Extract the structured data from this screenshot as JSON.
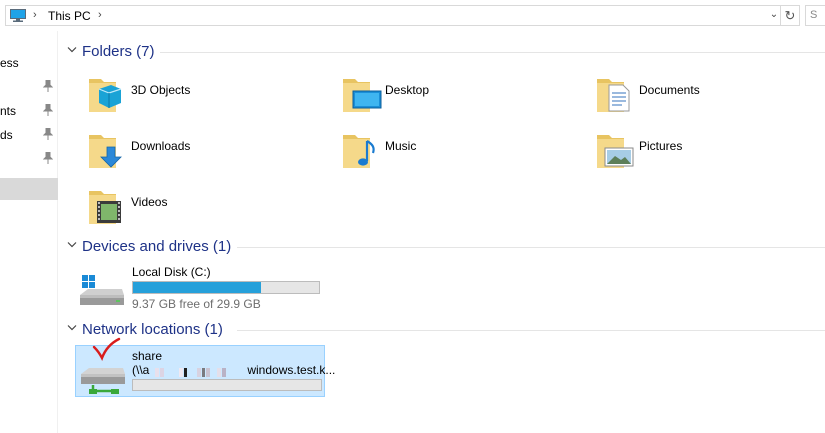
{
  "address_bar": {
    "crumb": "This PC",
    "search_placeholder": "S"
  },
  "nav": {
    "items": [
      {
        "label": "ess",
        "pinned": false
      },
      {
        "label": "nts",
        "pinned": true
      },
      {
        "label": "ds",
        "pinned": true
      },
      {
        "label": "",
        "pinned": true
      },
      {
        "label": "",
        "pinned": true
      }
    ]
  },
  "groups": {
    "folders": {
      "title": "Folders (7)",
      "items": [
        {
          "name": "3D Objects",
          "icon": "3d-objects-folder-icon"
        },
        {
          "name": "Desktop",
          "icon": "desktop-folder-icon"
        },
        {
          "name": "Documents",
          "icon": "documents-folder-icon"
        },
        {
          "name": "Downloads",
          "icon": "downloads-folder-icon"
        },
        {
          "name": "Music",
          "icon": "music-folder-icon"
        },
        {
          "name": "Pictures",
          "icon": "pictures-folder-icon"
        },
        {
          "name": "Videos",
          "icon": "videos-folder-icon"
        }
      ]
    },
    "devices": {
      "title": "Devices and drives (1)",
      "drive": {
        "name": "Local Disk (C:)",
        "free_text": "9.37 GB free of 29.9 GB",
        "used_fraction": 0.687
      }
    },
    "network": {
      "title": "Network locations (1)",
      "item": {
        "name": "share",
        "path_prefix": "(\\\\a",
        "path_suffix": "windows.test.k..."
      }
    }
  },
  "colors": {
    "group_title": "#1e3287",
    "selection_bg": "#cce8ff",
    "selection_border": "#99d1ff",
    "progress_fill": "#26a0da"
  }
}
